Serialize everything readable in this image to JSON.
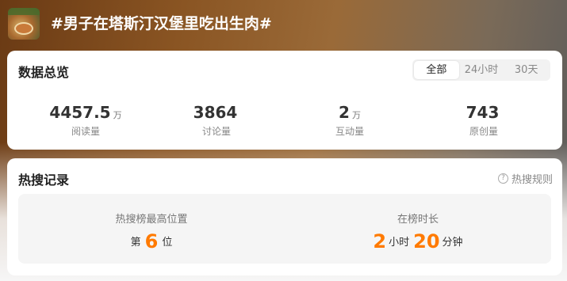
{
  "topic": {
    "title": "#男子在塔斯汀汉堡里吃出生肉#"
  },
  "overview": {
    "title": "数据总览",
    "tabs": [
      {
        "label": "全部",
        "active": true
      },
      {
        "label": "24小时",
        "active": false
      },
      {
        "label": "30天",
        "active": false
      }
    ],
    "stats": [
      {
        "value": "4457.5",
        "unit": "万",
        "label": "阅读量"
      },
      {
        "value": "3864",
        "unit": "",
        "label": "讨论量"
      },
      {
        "value": "2",
        "unit": "万",
        "label": "互动量"
      },
      {
        "value": "743",
        "unit": "",
        "label": "原创量"
      }
    ]
  },
  "hot_search": {
    "title": "热搜记录",
    "rules_label": "热搜规则",
    "rules_icon": "question-circle-icon",
    "peak": {
      "label": "热搜榜最高位置",
      "prefix": "第",
      "value": "6",
      "suffix": "位"
    },
    "duration": {
      "label": "在榜时长",
      "hours": "2",
      "hours_unit": "小时",
      "minutes": "20",
      "minutes_unit": "分钟"
    }
  },
  "colors": {
    "accent": "#ff7a00",
    "card_bg": "#ffffff"
  }
}
